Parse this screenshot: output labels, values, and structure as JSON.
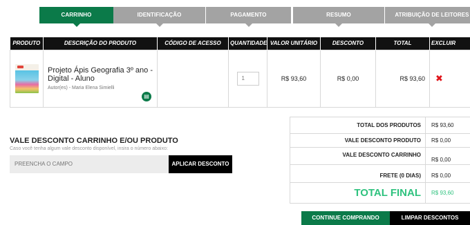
{
  "steps": [
    {
      "label": "CARRINHO",
      "active": true
    },
    {
      "label": "IDENTIFICAÇÃO",
      "active": false
    },
    {
      "label": "PAGAMENTO",
      "active": false
    },
    {
      "label": "RESUMO",
      "active": false
    },
    {
      "label": "ATRIBUIÇÃO DE LEITORES",
      "active": false
    }
  ],
  "cart": {
    "headers": {
      "product": "PRODUTO",
      "description": "DESCRIÇÃO DO PRODUTO",
      "access_code": "CÓDIGO DE ACESSO",
      "quantity": "QUANTIDADE",
      "unit_price": "VALOR UNITÁRIO",
      "discount": "DESCONTO",
      "total": "TOTAL",
      "remove": "EXCLUIR"
    },
    "items": [
      {
        "name": "Projeto Ápis Geografia 3º ano - Digital - Aluno",
        "author": "Autor(es) - Maria Elena Simielli",
        "access_code": "",
        "quantity_placeholder": "1",
        "unit_price": "R$ 93,60",
        "discount": "R$ 0,00",
        "total": "R$ 93,60",
        "remove_icon": "✖",
        "badge_icon": "ebook-icon"
      }
    ]
  },
  "voucher": {
    "title": "VALE DESCONTO CARRINHO E/OU PRODUTO",
    "help": "Caso você tenha algum vale desconto disponível, insira o número abaixo:",
    "placeholder": "PREENCHA O CAMPO",
    "apply_label": "APLICAR DESCONTO"
  },
  "totals": {
    "products_label": "TOTAL DOS PRODUTOS",
    "products_value": "R$ 93,60",
    "product_discount_label": "VALE DESCONTO PRODUTO",
    "product_discount_value": "R$ 0,00",
    "cart_discount_label": "VALE DESCONTO CARRINHO",
    "cart_discount_value": "R$ 0,00",
    "shipping_label": "FRETE (0 DIAS)",
    "shipping_value": "R$ 0,00",
    "final_label": "TOTAL FINAL",
    "final_value": "R$ 93,60"
  },
  "actions": {
    "continue_label": "CONTINUE COMPRANDO",
    "clear_label": "LIMPAR DESCONTOS"
  },
  "colors": {
    "accent_green": "#0b7a49",
    "final_green": "#2ec27e",
    "inactive_step": "#a3a3a3",
    "remove_red": "#e0151b"
  }
}
